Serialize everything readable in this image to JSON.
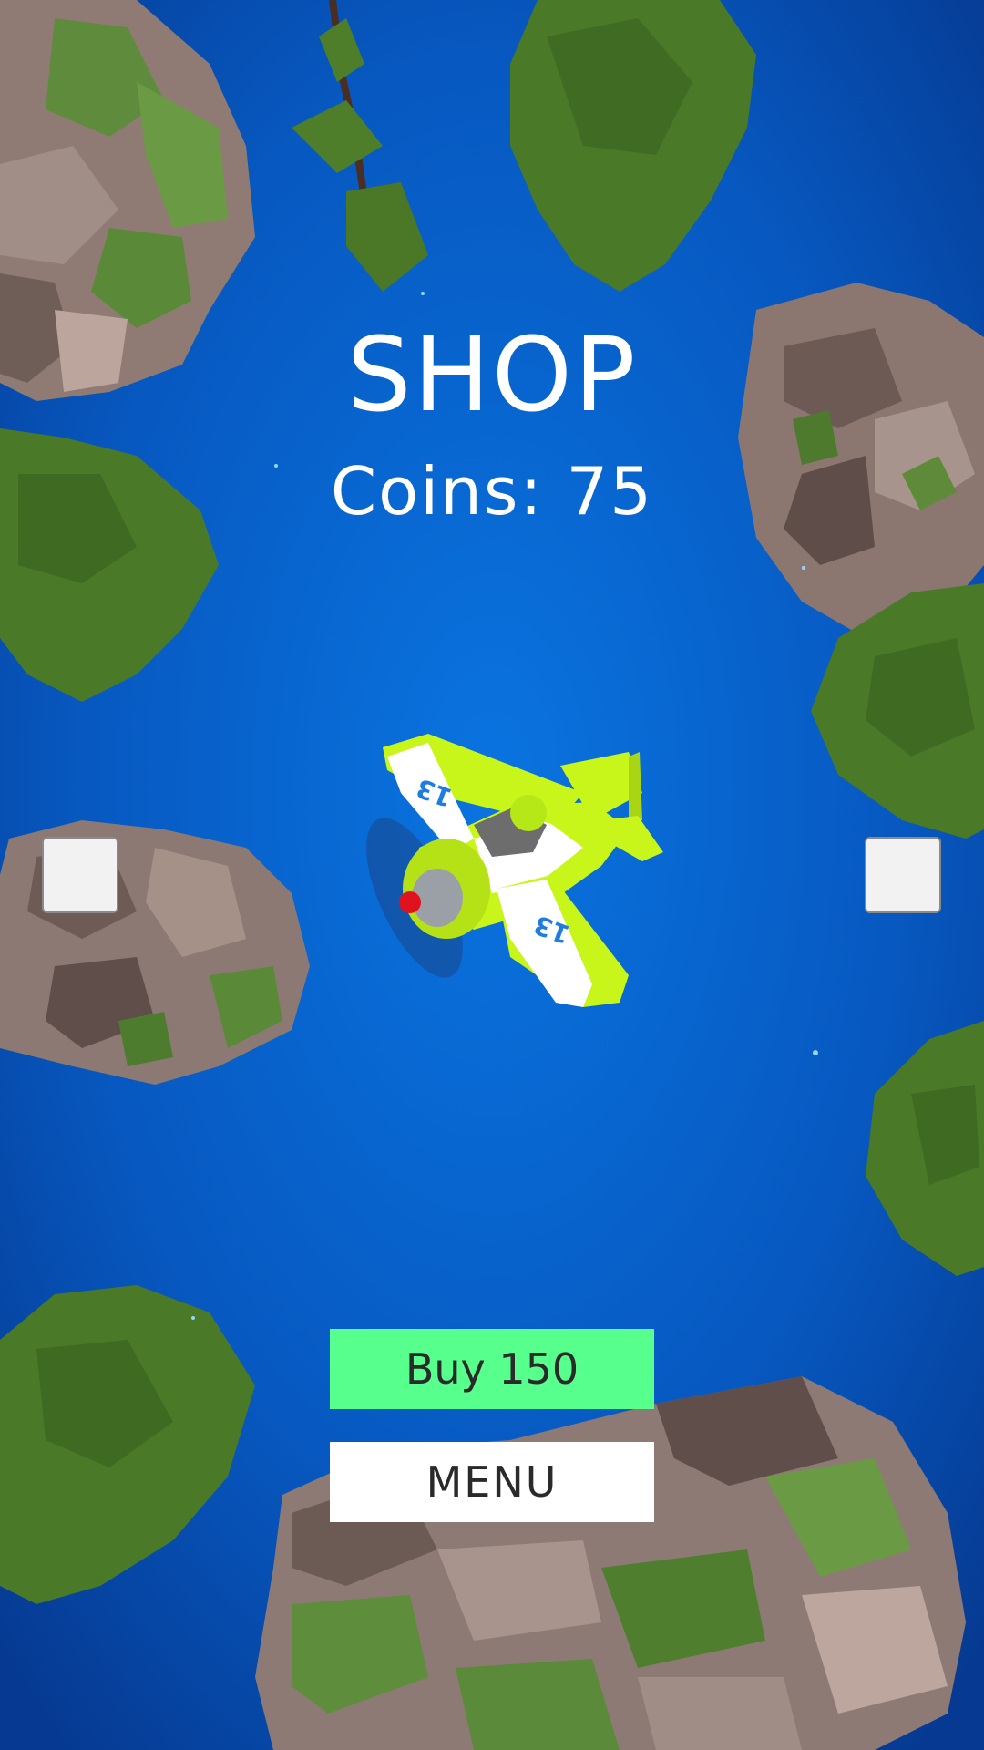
{
  "screen": {
    "title": "SHOP",
    "coins_label": "Coins: 75"
  },
  "plane": {
    "number": "13"
  },
  "buttons": {
    "buy_label": "Buy 150",
    "menu_label": "MENU"
  },
  "colors": {
    "sky_center": "#0a6fd8",
    "sky_edge": "#0a3c9c",
    "buy_button": "#57ff8c",
    "menu_button": "#ffffff",
    "plane_body": "#c8f51a",
    "rock": "#8c7872",
    "foliage": "#4a7a2a"
  }
}
